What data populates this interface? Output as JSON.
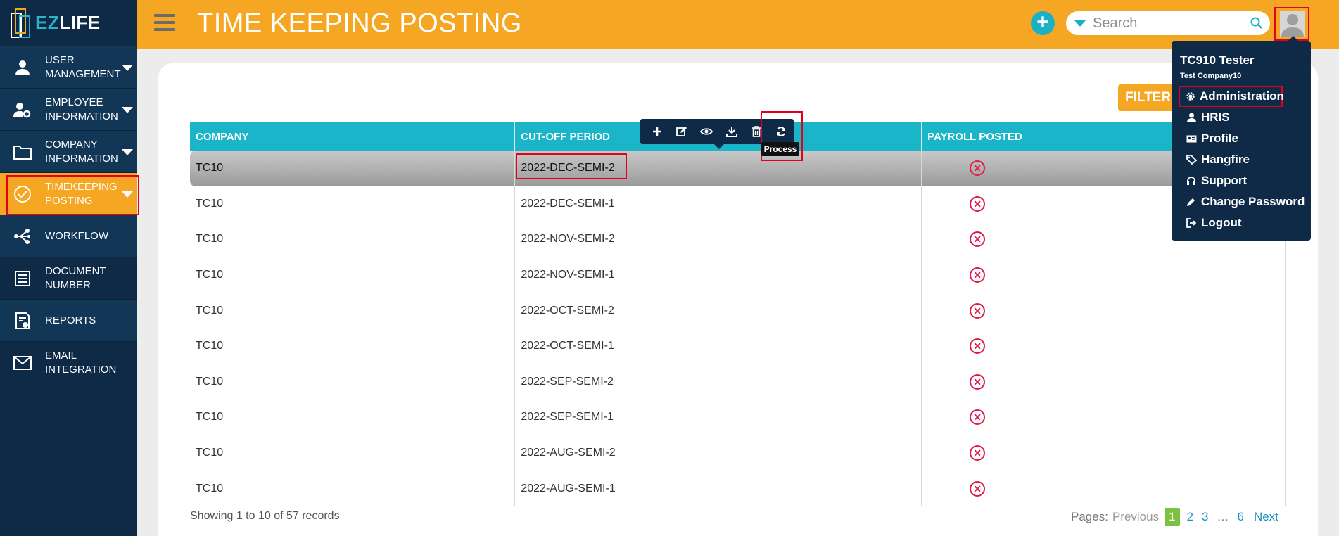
{
  "app": {
    "logo_text_accent": "EZ",
    "logo_text_main": "LIFE"
  },
  "sidebar": {
    "items": [
      {
        "label": "USER MANAGEMENT",
        "icon": "user-icon",
        "has_caret": true
      },
      {
        "label": "EMPLOYEE INFORMATION",
        "icon": "user-gear-icon",
        "has_caret": true
      },
      {
        "label": "COMPANY INFORMATION",
        "icon": "folder-icon",
        "has_caret": true
      },
      {
        "label": "TIMEKEEPING POSTING",
        "icon": "check-circle-icon",
        "has_caret": true,
        "active": true
      },
      {
        "label": "WORKFLOW",
        "icon": "workflow-icon",
        "has_caret": false
      },
      {
        "label": "DOCUMENT NUMBER",
        "icon": "document-list-icon",
        "has_caret": false
      },
      {
        "label": "REPORTS",
        "icon": "report-icon",
        "has_caret": false
      },
      {
        "label": "EMAIL INTEGRATION",
        "icon": "envelope-icon",
        "has_caret": false
      }
    ]
  },
  "header": {
    "title": "TIME KEEPING POSTING",
    "search_placeholder": "Search"
  },
  "toolbar": {
    "filter_label": "FILTER",
    "row_actions": [
      "plus-icon",
      "edit-icon",
      "eye-icon",
      "download-icon",
      "trash-icon",
      "refresh-icon"
    ],
    "tooltip": "Process"
  },
  "table": {
    "columns": [
      "COMPANY",
      "CUT-OFF PERIOD",
      "PAYROLL POSTED"
    ],
    "rows": [
      {
        "company": "TC10",
        "cutoff": "2022-DEC-SEMI-2",
        "posted": false
      },
      {
        "company": "TC10",
        "cutoff": "2022-DEC-SEMI-1",
        "posted": false
      },
      {
        "company": "TC10",
        "cutoff": "2022-NOV-SEMI-2",
        "posted": false
      },
      {
        "company": "TC10",
        "cutoff": "2022-NOV-SEMI-1",
        "posted": false
      },
      {
        "company": "TC10",
        "cutoff": "2022-OCT-SEMI-2",
        "posted": false
      },
      {
        "company": "TC10",
        "cutoff": "2022-OCT-SEMI-1",
        "posted": false
      },
      {
        "company": "TC10",
        "cutoff": "2022-SEP-SEMI-2",
        "posted": false
      },
      {
        "company": "TC10",
        "cutoff": "2022-SEP-SEMI-1",
        "posted": false
      },
      {
        "company": "TC10",
        "cutoff": "2022-AUG-SEMI-2",
        "posted": false
      },
      {
        "company": "TC10",
        "cutoff": "2022-AUG-SEMI-1",
        "posted": false
      }
    ],
    "footer_text": "Showing 1 to 10 of 57 records"
  },
  "pagination": {
    "label": "Pages:",
    "previous": "Previous",
    "current": "1",
    "pages": [
      "2",
      "3"
    ],
    "ellipsis": "…",
    "last": "6",
    "next": "Next"
  },
  "user_menu": {
    "name": "TC910 Tester",
    "company": "Test Company10",
    "items": [
      {
        "label": "Administration",
        "icon": "gear-icon"
      },
      {
        "label": "HRIS",
        "icon": "user-icon"
      },
      {
        "label": "Profile",
        "icon": "id-card-icon"
      },
      {
        "label": "Hangfire",
        "icon": "tags-icon"
      },
      {
        "label": "Support",
        "icon": "headset-icon"
      },
      {
        "label": "Change Password",
        "icon": "pencil-icon"
      },
      {
        "label": "Logout",
        "icon": "sign-out-icon"
      }
    ]
  },
  "colors": {
    "accent": "#f5a623",
    "sidebar_bg": "#0e2a47",
    "table_header": "#1ab5c8",
    "highlight": "#e3001b",
    "not_posted": "#e0194b"
  }
}
